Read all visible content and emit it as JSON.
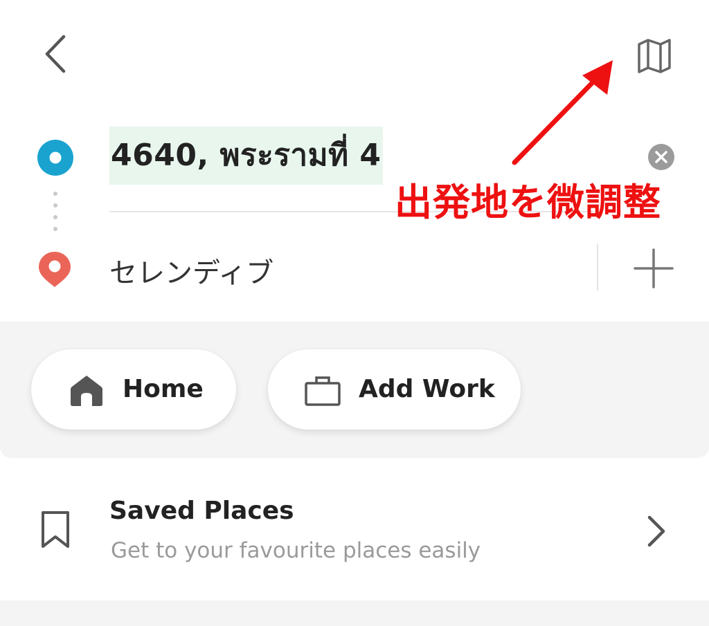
{
  "header": {
    "back_icon": "chevron-left-icon",
    "map_icon": "map-icon"
  },
  "route": {
    "origin": {
      "value": "4640, พระรามที่ 4",
      "dot_color": "#1aa3cf",
      "highlight_color": "#e8f6ee"
    },
    "destination": {
      "value": "セレンディブ",
      "pin_color": "#ea6558"
    },
    "add_stop_icon": "plus-icon",
    "clear_icon": "clear-icon"
  },
  "annotation": {
    "text": "出発地を微調整",
    "color": "#ee1111"
  },
  "shortcuts": [
    {
      "label": "Home",
      "icon": "home-icon"
    },
    {
      "label": "Add Work",
      "icon": "briefcase-icon"
    }
  ],
  "saved_places": {
    "title": "Saved Places",
    "subtitle": "Get to your favourite places easily",
    "icon": "bookmark-icon"
  }
}
